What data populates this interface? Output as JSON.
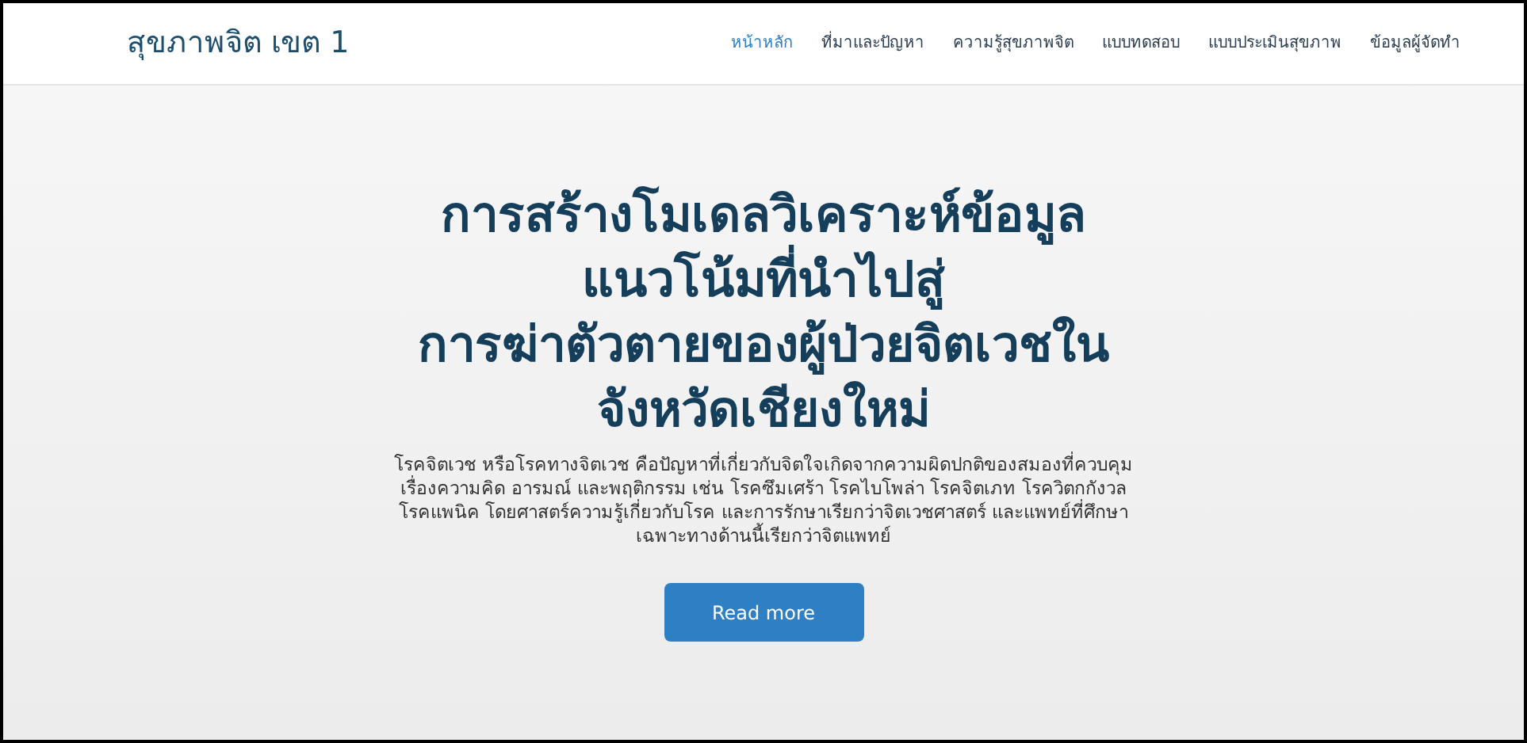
{
  "site_title": "สุขภาพจิต เขต 1",
  "nav": [
    {
      "label": "หน้าหลัก",
      "selected": true
    },
    {
      "label": "ที่มาและปัญหา",
      "selected": false
    },
    {
      "label": "ความรู้สุขภาพจิต",
      "selected": false
    },
    {
      "label": "แบบทดสอบ",
      "selected": false
    },
    {
      "label": "แบบประเมินสุขภาพ",
      "selected": false
    },
    {
      "label": "ข้อมูลผู้จัดทำ",
      "selected": false
    }
  ],
  "hero": {
    "title_lines": [
      "การสร้างโมเดลวิเคราะห์ข้อมูล",
      "แนวโน้มที่นำไปสู่",
      "การฆ่าตัวตายของผู้ป่วยจิตเวชใน",
      "จังหวัดเชียงใหม่"
    ],
    "description": "โรคจิตเวช หรือโรคทางจิตเวช คือปัญหาที่เกี่ยวกับจิตใจเกิดจากความผิดปกติของสมองที่ควบคุมเรื่องความคิด อารมณ์ และพฤติกรรม เช่น โรคซึมเศร้า โรคไบโพล่า โรคจิตเภท โรควิตกกังวล โรคแพนิค โดยศาสตร์ความรู้เกี่ยวกับโรค และการรักษาเรียกว่าจิตเวชศาสตร์ และแพทย์ที่ศึกษาเฉพาะทางด้านนี้เรียกว่าจิตแพทย์",
    "button": "Read more"
  }
}
